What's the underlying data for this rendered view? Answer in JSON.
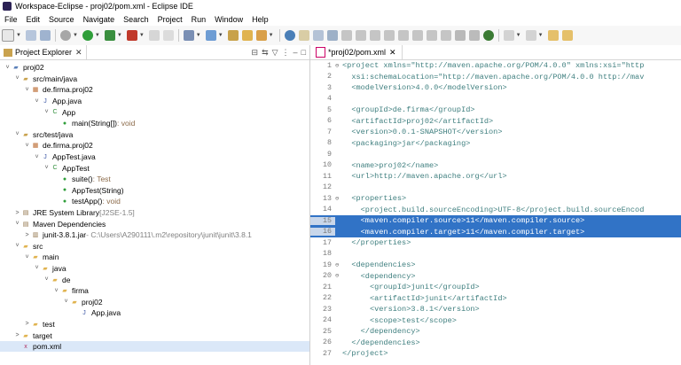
{
  "window": {
    "title": "Workspace-Eclipse - proj02/pom.xml - Eclipse IDE"
  },
  "menu": [
    "File",
    "Edit",
    "Source",
    "Navigate",
    "Search",
    "Project",
    "Run",
    "Window",
    "Help"
  ],
  "explorer": {
    "tab_label": "Project Explorer",
    "tab_close": "✕",
    "tree": [
      {
        "depth": 0,
        "arrow": "˅",
        "icon": "project-folder-icon",
        "label": "proj02",
        "extra": ""
      },
      {
        "depth": 1,
        "arrow": "˅",
        "icon": "source-folder-icon",
        "label": "src/main/java",
        "extra": ""
      },
      {
        "depth": 2,
        "arrow": "˅",
        "icon": "package-icon",
        "label": "de.firma.proj02",
        "extra": ""
      },
      {
        "depth": 3,
        "arrow": "˅",
        "icon": "java-file-icon",
        "label": "App.java",
        "extra": ""
      },
      {
        "depth": 4,
        "arrow": "˅",
        "icon": "class-icon",
        "label": "App",
        "extra": ""
      },
      {
        "depth": 5,
        "arrow": "",
        "icon": "method-icon",
        "label": "main(String[])",
        "extra": " : void"
      },
      {
        "depth": 1,
        "arrow": "˅",
        "icon": "source-folder-icon",
        "label": "src/test/java",
        "extra": ""
      },
      {
        "depth": 2,
        "arrow": "˅",
        "icon": "package-icon",
        "label": "de.firma.proj02",
        "extra": ""
      },
      {
        "depth": 3,
        "arrow": "˅",
        "icon": "java-file-icon",
        "label": "AppTest.java",
        "extra": ""
      },
      {
        "depth": 4,
        "arrow": "˅",
        "icon": "class-icon",
        "label": "AppTest",
        "extra": ""
      },
      {
        "depth": 5,
        "arrow": "",
        "icon": "static-method-icon",
        "label": "suite()",
        "extra": " : Test"
      },
      {
        "depth": 5,
        "arrow": "",
        "icon": "constructor-icon",
        "label": "AppTest(String)",
        "extra": ""
      },
      {
        "depth": 5,
        "arrow": "",
        "icon": "method-icon",
        "label": "testApp()",
        "extra": " : void"
      },
      {
        "depth": 1,
        "arrow": ">",
        "icon": "library-icon",
        "label": "JRE System Library",
        "extra": " [J2SE-1.5]"
      },
      {
        "depth": 1,
        "arrow": "˅",
        "icon": "library-icon",
        "label": "Maven Dependencies",
        "extra": ""
      },
      {
        "depth": 2,
        "arrow": ">",
        "icon": "jar-icon",
        "label": "junit-3.8.1.jar",
        "extra": " - C:\\Users\\A290111\\.m2\\repository\\junit\\junit\\3.8.1"
      },
      {
        "depth": 1,
        "arrow": "˅",
        "icon": "folder-icon",
        "label": "src",
        "extra": ""
      },
      {
        "depth": 2,
        "arrow": "˅",
        "icon": "folder-icon",
        "label": "main",
        "extra": ""
      },
      {
        "depth": 3,
        "arrow": "˅",
        "icon": "folder-icon",
        "label": "java",
        "extra": ""
      },
      {
        "depth": 4,
        "arrow": "˅",
        "icon": "folder-icon",
        "label": "de",
        "extra": ""
      },
      {
        "depth": 5,
        "arrow": "˅",
        "icon": "folder-icon",
        "label": "firma",
        "extra": ""
      },
      {
        "depth": 6,
        "arrow": "˅",
        "icon": "folder-icon",
        "label": "proj02",
        "extra": ""
      },
      {
        "depth": 7,
        "arrow": "",
        "icon": "java-file-icon",
        "label": "App.java",
        "extra": ""
      },
      {
        "depth": 2,
        "arrow": ">",
        "icon": "folder-icon",
        "label": "test",
        "extra": ""
      },
      {
        "depth": 1,
        "arrow": ">",
        "icon": "folder-icon",
        "label": "target",
        "extra": ""
      },
      {
        "depth": 1,
        "arrow": "",
        "icon": "xml-file-icon",
        "label": "pom.xml",
        "extra": ""
      }
    ]
  },
  "editor": {
    "tab_label": "*proj02/pom.xml",
    "tab_close": "✕",
    "lines": [
      {
        "n": "1",
        "fold": "⊖",
        "t": "<project xmlns=\"http://maven.apache.org/POM/4.0.0\" xmlns:xsi=\"http"
      },
      {
        "n": "2",
        "fold": "",
        "t": "  xsi:schemaLocation=\"http://maven.apache.org/POM/4.0.0 http://mav"
      },
      {
        "n": "3",
        "fold": "",
        "t": "  <modelVersion>4.0.0</modelVersion>"
      },
      {
        "n": "4",
        "fold": "",
        "t": ""
      },
      {
        "n": "5",
        "fold": "",
        "t": "  <groupId>de.firma</groupId>"
      },
      {
        "n": "6",
        "fold": "",
        "t": "  <artifactId>proj02</artifactId>"
      },
      {
        "n": "7",
        "fold": "",
        "t": "  <version>0.0.1-SNAPSHOT</version>"
      },
      {
        "n": "8",
        "fold": "",
        "t": "  <packaging>jar</packaging>"
      },
      {
        "n": "9",
        "fold": "",
        "t": ""
      },
      {
        "n": "10",
        "fold": "",
        "t": "  <name>proj02</name>"
      },
      {
        "n": "11",
        "fold": "",
        "t": "  <url>http://maven.apache.org</url>"
      },
      {
        "n": "12",
        "fold": "",
        "t": ""
      },
      {
        "n": "13",
        "fold": "⊖",
        "t": "  <properties>"
      },
      {
        "n": "14",
        "fold": "",
        "t": "    <project.build.sourceEncoding>UTF-8</project.build.sourceEncod"
      },
      {
        "n": "15",
        "fold": "",
        "t": "    <maven.compiler.source>11</maven.compiler.source>",
        "sel": true
      },
      {
        "n": "16",
        "fold": "",
        "t": "    <maven.compiler.target>11</maven.compiler.target>",
        "sel": true
      },
      {
        "n": "17",
        "fold": "",
        "t": "  </properties>"
      },
      {
        "n": "18",
        "fold": "",
        "t": ""
      },
      {
        "n": "19",
        "fold": "⊖",
        "t": "  <dependencies>"
      },
      {
        "n": "20",
        "fold": "⊖",
        "t": "    <dependency>"
      },
      {
        "n": "21",
        "fold": "",
        "t": "      <groupId>junit</groupId>"
      },
      {
        "n": "22",
        "fold": "",
        "t": "      <artifactId>junit</artifactId>"
      },
      {
        "n": "23",
        "fold": "",
        "t": "      <version>3.8.1</version>"
      },
      {
        "n": "24",
        "fold": "",
        "t": "      <scope>test</scope>"
      },
      {
        "n": "25",
        "fold": "",
        "t": "    </dependency>"
      },
      {
        "n": "26",
        "fold": "",
        "t": "  </dependencies>"
      },
      {
        "n": "27",
        "fold": "",
        "t": "</project>"
      }
    ]
  }
}
